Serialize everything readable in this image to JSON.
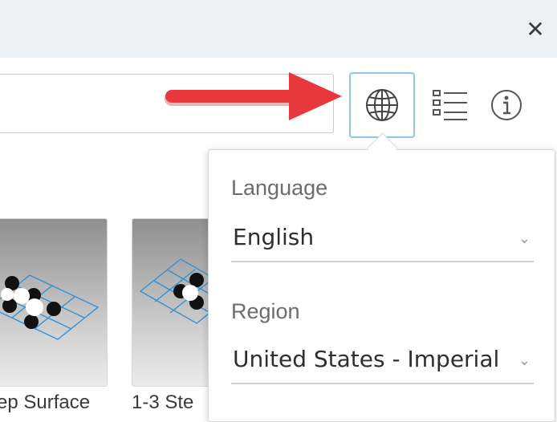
{
  "window": {
    "close_glyph": "✕"
  },
  "toolbar": {
    "search_placeholder": "",
    "icons": [
      "globe-icon",
      "list-icon",
      "info-icon"
    ]
  },
  "annotation": {
    "arrow_color": "#e8383d"
  },
  "thumbnails": [
    {
      "label": "ep Surface"
    },
    {
      "label": "1-3 Ste"
    }
  ],
  "language_popover": {
    "language_label": "Language",
    "language_value": "English",
    "region_label": "Region",
    "region_value": "United States - Imperial"
  },
  "colors": {
    "accent": "#8cc6ee",
    "titlebar": "#eef1f4",
    "grid_line": "#2d8fd6"
  }
}
